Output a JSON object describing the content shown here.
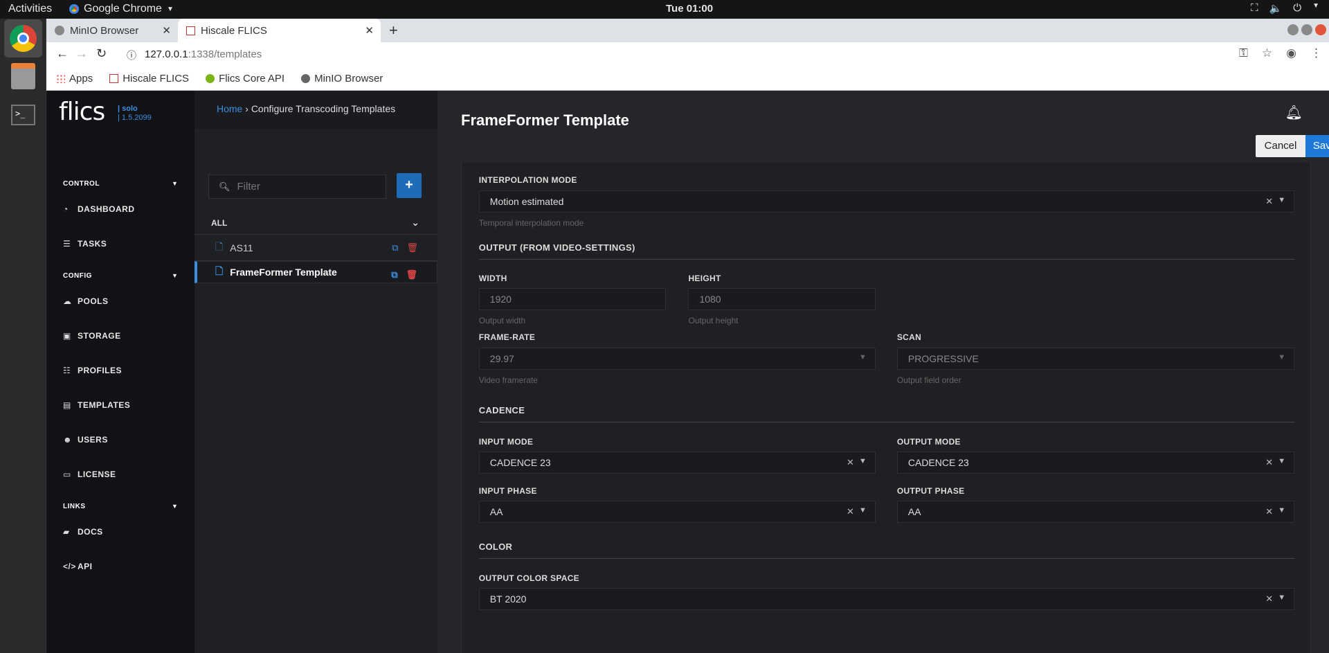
{
  "os": {
    "activities": "Activities",
    "app_name": "Google Chrome",
    "clock": "Tue 01:00"
  },
  "browser": {
    "tabs": [
      {
        "label": "MinIO Browser"
      },
      {
        "label": "Hiscale FLICS"
      }
    ],
    "url_host": "127.0.0.1",
    "url_path": ":1338/templates",
    "bookmarks": [
      {
        "label": "Apps"
      },
      {
        "label": "Hiscale FLICS"
      },
      {
        "label": "Flics Core API"
      },
      {
        "label": "MinIO Browser"
      }
    ]
  },
  "sidebar": {
    "logo": "flics",
    "edition": "| solo",
    "version": "| 1.5.2099",
    "sections": [
      {
        "label": "CONTROL"
      },
      {
        "label": "CONFIG"
      },
      {
        "label": "LINKS"
      }
    ],
    "items": [
      {
        "label": "DASHBOARD",
        "icon": "dashboard-icon"
      },
      {
        "label": "TASKS",
        "icon": "tasks-icon"
      },
      {
        "label": "POOLS",
        "icon": "cloud-icon"
      },
      {
        "label": "STORAGE",
        "icon": "storage-icon"
      },
      {
        "label": "PROFILES",
        "icon": "sliders-icon"
      },
      {
        "label": "TEMPLATES",
        "icon": "document-icon"
      },
      {
        "label": "USERS",
        "icon": "users-icon"
      },
      {
        "label": "LICENSE",
        "icon": "license-icon"
      },
      {
        "label": "DOCS",
        "icon": "book-icon"
      },
      {
        "label": "API",
        "icon": "code-icon"
      }
    ]
  },
  "breadcrumb": {
    "home": "Home",
    "separator": "›",
    "current": "Configure Transcoding Templates"
  },
  "list": {
    "filter_placeholder": "Filter",
    "group": "ALL",
    "items": [
      {
        "label": "AS11"
      },
      {
        "label": "FrameFormer Template"
      }
    ]
  },
  "form": {
    "title": "FrameFormer Template",
    "cancel": "Cancel",
    "save": "Save",
    "interpolation": {
      "label": "INTERPOLATION MODE",
      "value": "Motion estimated",
      "hint": "Temporal interpolation mode"
    },
    "output_header": "OUTPUT (FROM VIDEO-SETTINGS)",
    "width": {
      "label": "WIDTH",
      "value": "1920",
      "hint": "Output width"
    },
    "height": {
      "label": "HEIGHT",
      "value": "1080",
      "hint": "Output height"
    },
    "framerate": {
      "label": "FRAME-RATE",
      "value": "29.97",
      "hint": "Video framerate"
    },
    "scan": {
      "label": "SCAN",
      "value": "PROGRESSIVE",
      "hint": "Output field order"
    },
    "cadence_header": "CADENCE",
    "input_mode": {
      "label": "INPUT MODE",
      "value": "CADENCE 23"
    },
    "output_mode": {
      "label": "OUTPUT MODE",
      "value": "CADENCE 23"
    },
    "input_phase": {
      "label": "INPUT PHASE",
      "value": "AA"
    },
    "output_phase": {
      "label": "OUTPUT PHASE",
      "value": "AA"
    },
    "color_header": "COLOR",
    "color_space": {
      "label": "OUTPUT COLOR SPACE",
      "value": "BT 2020"
    }
  },
  "colors": {
    "accent": "#3b8fe0",
    "save": "#1e7ad9",
    "delete": "#dd4444"
  }
}
